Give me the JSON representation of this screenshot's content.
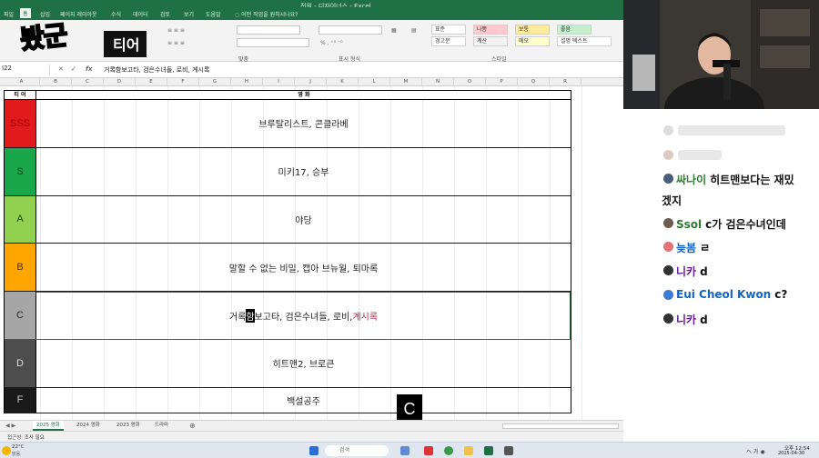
{
  "excel": {
    "title": "전원 - 디자이너스 - Excel",
    "tabs": [
      "파일",
      "홈",
      "삽입",
      "페이지 레이아웃",
      "수식",
      "데이터",
      "검토",
      "보기",
      "도움말"
    ],
    "active_tab": "홈",
    "tell_me": "어떤 작업을 원하시나요?",
    "groups": [
      "맞춤",
      "표시 형식",
      "스타일"
    ],
    "styles": [
      "표준",
      "나쁨",
      "보통",
      "좋음",
      "경고문",
      "계산",
      "메모",
      "설명 텍스트"
    ],
    "name_box": "I22",
    "formula": "거록함보고타, 검은수녀들, 로비, 계시록"
  },
  "logo": {
    "brand": "봤군",
    "tier": "티어"
  },
  "sheet": {
    "columns": [
      "A",
      "B",
      "C",
      "D",
      "E",
      "F",
      "G",
      "H",
      "I",
      "J",
      "K",
      "L",
      "M",
      "N",
      "O",
      "P",
      "Q",
      "R"
    ],
    "header_tier": "티 어",
    "header_movie": "영 화",
    "rows": [
      {
        "tier": "SSS",
        "color": "#e11b1b",
        "text_color": "#a80000",
        "movies": "브루탈리스트, 콘클라베"
      },
      {
        "tier": "S",
        "color": "#1aa64a",
        "text_color": "#0b3b18",
        "movies": "미키17, 승부"
      },
      {
        "tier": "A",
        "color": "#92d050",
        "text_color": "#2a3c14",
        "movies": "야당"
      },
      {
        "tier": "B",
        "color": "#ffa500",
        "text_color": "#4a3200",
        "movies": "말할 수 없는 비밀, 캡아 브뉴월, 퇴마록"
      },
      {
        "tier": "C",
        "color": "#a6a6a6",
        "text_color": "#2b2b2b",
        "movies_pre": "거록",
        "movies_cursor": "함",
        "movies_mid": "보고타, 검은수녀들, 로비, ",
        "movies_hl": "계시록"
      },
      {
        "tier": "D",
        "color": "#4d4d4d",
        "text_color": "#dddddd",
        "movies": "히트맨2, 브로큰"
      },
      {
        "tier": "F",
        "color": "#1a1a1a",
        "text_color": "#cccccc",
        "movies": "백설공주"
      }
    ]
  },
  "sheet_tabs": [
    "2025 영화",
    "2024 영화",
    "2023 영화",
    "드라마"
  ],
  "active_sheet": "2025 영화",
  "status": "접근성: 조사 필요",
  "overlay_letter": "C",
  "taskbar": {
    "temp": "22°C",
    "weather": "맑음",
    "search": "검색",
    "time": "오후 12:54",
    "date": "2025-04-30"
  },
  "chat": [
    {
      "nick": "",
      "text": "",
      "faded": true
    },
    {
      "nick": "",
      "text": "",
      "faded": true
    },
    {
      "nick": "싸나이",
      "text": "히트맨보다는 재밌",
      "nick_class": ""
    },
    {
      "nick": "",
      "text": "겠지",
      "continuation": true
    },
    {
      "nick": "Ssol",
      "text": "c가 검은수녀인데",
      "nick_class": ""
    },
    {
      "nick": "늦봄",
      "text": "ㄹ",
      "nick_class": "blue"
    },
    {
      "nick": "니카",
      "text": "d",
      "nick_class": "purple"
    },
    {
      "nick": "Eui Cheol Kwon",
      "text": "c?",
      "nick_class": "blue"
    },
    {
      "nick": "니카",
      "text": "d",
      "nick_class": "purple"
    }
  ]
}
